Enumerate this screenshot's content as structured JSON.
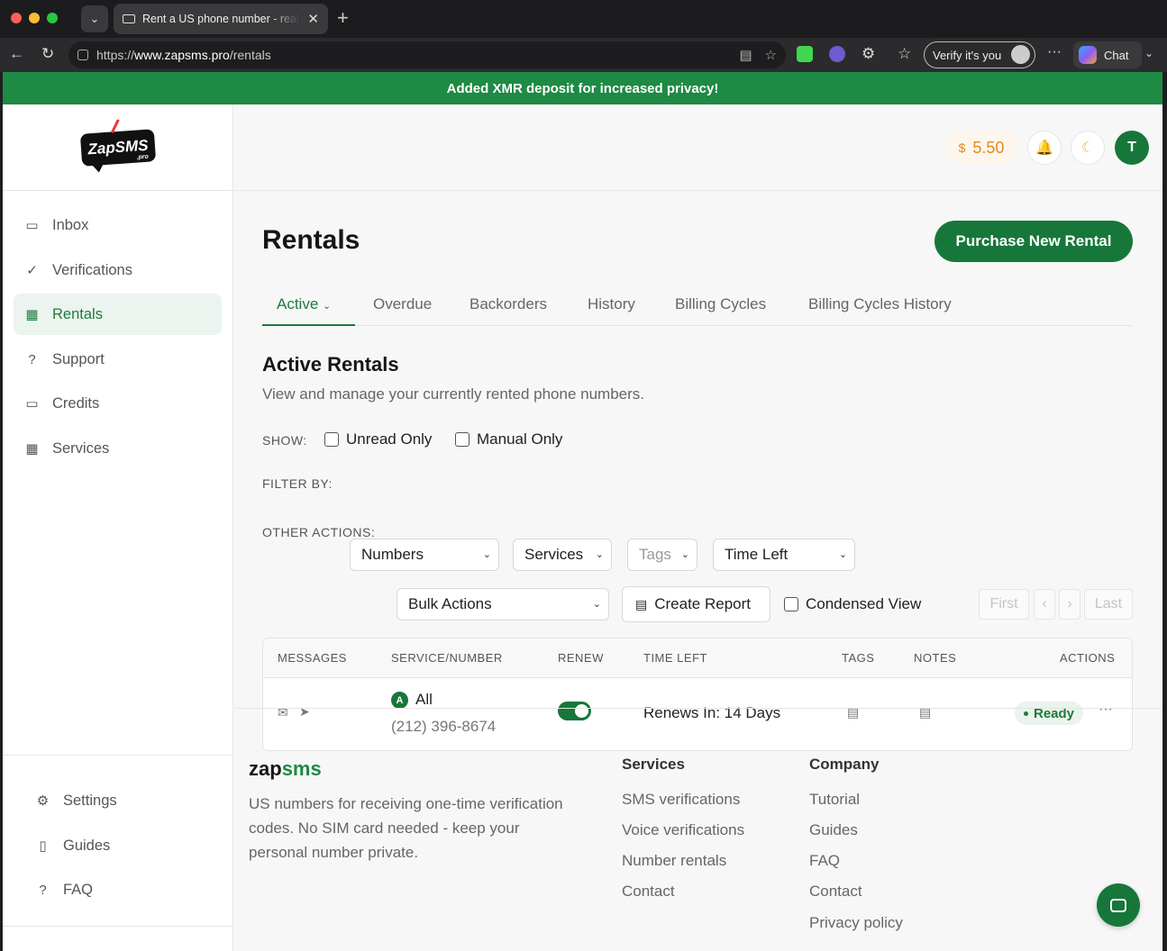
{
  "browser": {
    "tab_title": "Rent a US phone number - real n",
    "url_prefix": "https://",
    "url_domain": "www.zapsms.pro",
    "url_path": "/rentals",
    "verify_label": "Verify it's you",
    "chat_label": "Chat"
  },
  "banner": {
    "text": "Added XMR deposit for increased privacy!"
  },
  "sidebar": {
    "logo_text": "ZapSMS",
    "logo_suffix": ".pro",
    "items": [
      {
        "label": "Inbox",
        "icon": "inbox-icon"
      },
      {
        "label": "Verifications",
        "icon": "check-circle-icon"
      },
      {
        "label": "Rentals",
        "icon": "calendar-icon"
      },
      {
        "label": "Support",
        "icon": "help-icon"
      },
      {
        "label": "Credits",
        "icon": "card-icon"
      },
      {
        "label": "Services",
        "icon": "grid-icon"
      }
    ],
    "bottom_items": [
      {
        "label": "Settings",
        "icon": "gear-icon"
      },
      {
        "label": "Guides",
        "icon": "book-icon"
      },
      {
        "label": "FAQ",
        "icon": "help-icon"
      }
    ]
  },
  "topbar": {
    "currency": "$",
    "balance": "5.50",
    "avatar_letter": "T"
  },
  "main": {
    "title": "Rentals",
    "purchase_label": "Purchase New Rental",
    "tabs": [
      "Active",
      "Overdue",
      "Backorders",
      "History",
      "Billing Cycles",
      "Billing Cycles History"
    ],
    "section_title": "Active Rentals",
    "section_sub": "View and manage your currently rented phone numbers.",
    "show_label": "SHOW:",
    "unread_only": "Unread Only",
    "manual_only": "Manual Only",
    "filter_label": "FILTER BY:",
    "filters": [
      "Numbers",
      "Services",
      "Tags",
      "Time Left"
    ],
    "other_label": "OTHER ACTIONS:",
    "bulk_actions": "Bulk Actions",
    "create_report": "Create Report",
    "condensed_view": "Condensed View",
    "pager": {
      "first": "First",
      "prev": "‹",
      "next": "›",
      "last": "Last"
    }
  },
  "table": {
    "headers": [
      "MESSAGES",
      "SERVICE/NUMBER",
      "RENEW",
      "TIME LEFT",
      "TAGS",
      "NOTES",
      "ACTIONS"
    ],
    "rows": [
      {
        "service_badge": "A",
        "service": "All",
        "number": "(212) 396-8674",
        "renew": true,
        "time_left": "Renews In: 14 Days",
        "status": "Ready"
      }
    ]
  },
  "footer": {
    "brand_a": "zap",
    "brand_b": "sms",
    "description": "US numbers for receiving one-time verification codes. No SIM card needed - keep your personal number private.",
    "services_heading": "Services",
    "services_links": [
      "SMS verifications",
      "Voice verifications",
      "Number rentals",
      "Contact"
    ],
    "company_heading": "Company",
    "company_links": [
      "Tutorial",
      "Guides",
      "FAQ",
      "Contact",
      "Privacy policy"
    ]
  },
  "colors": {
    "brand_green": "#17773a",
    "banner_green": "#1e8a43",
    "balance_orange": "#e38b1c"
  }
}
